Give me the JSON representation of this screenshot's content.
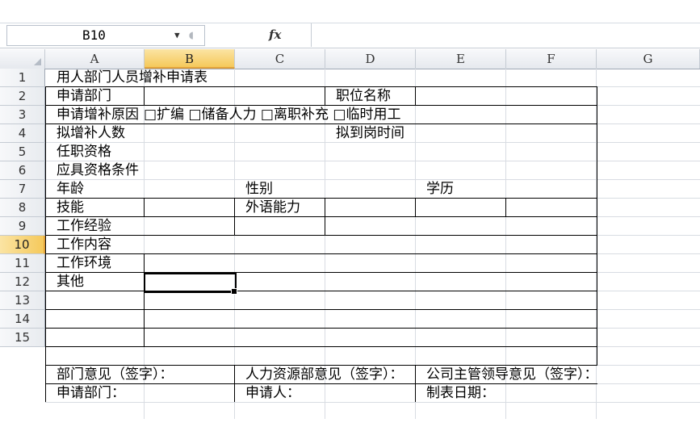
{
  "name_box": {
    "value": "B10",
    "dropdown_icon": "chevron-down-icon",
    "cancel_icon": "cancel-icon"
  },
  "formula_bar": {
    "fx_label": "fx",
    "value": ""
  },
  "columns": [
    "A",
    "B",
    "C",
    "D",
    "E",
    "F",
    "G"
  ],
  "selected_column": "B",
  "rows": [
    "1",
    "2",
    "3",
    "4",
    "5",
    "6",
    "7",
    "8",
    "9",
    "10",
    "11",
    "12",
    "13",
    "14",
    "15"
  ],
  "selected_row": "10",
  "cells": {
    "A1": "用人部门人员增补申请表",
    "A2": "申请部门",
    "D2": "职位名称",
    "A3": "申请增补原因",
    "B3": "□扩编 □储备人力 □离职补充 □临时用工",
    "A4": "拟增补人数",
    "D4": "拟到岗时间",
    "A5": "任职资格",
    "A6": "应具资格条件",
    "A7": "年龄",
    "C7": "性别",
    "E7": "学历",
    "A8": "技能",
    "C8": "外语能力",
    "A9": "工作经验",
    "A10": "工作内容",
    "A11": "工作环境",
    "A12": "其他",
    "A14": "部门意见（签字）：",
    "C14": "人力资源部意见（签字）：",
    "E14": "公司主管领导意见（签字）：",
    "A15": "申请部门：",
    "C15": "申请人：",
    "E15": "制表日期："
  },
  "active_cell": "B10"
}
